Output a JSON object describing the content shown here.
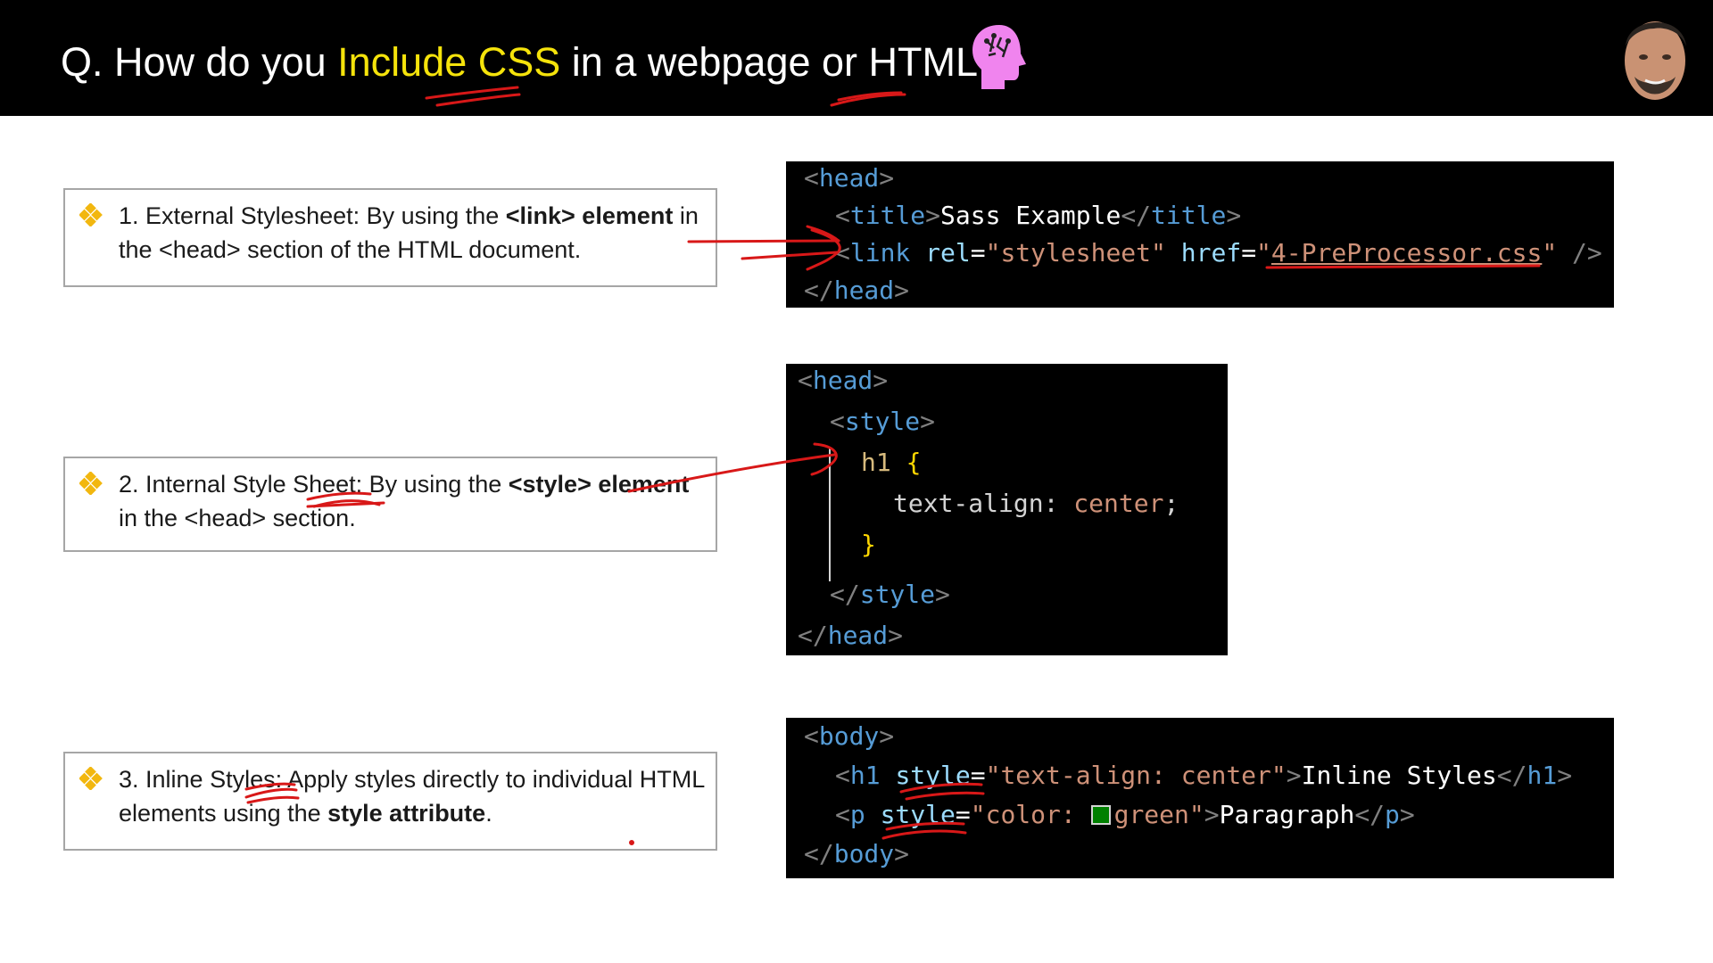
{
  "header": {
    "title_prefix": "Q. How do you ",
    "title_highlight": "Include CSS",
    "title_suffix": " in a webpage or HTML?"
  },
  "methods": [
    {
      "lead": "1. External Stylesheet: By using the ",
      "bold1": "<link> element",
      "rest": " in the <head> section of the HTML document."
    },
    {
      "lead": "2. Internal Style Sheet: By using the ",
      "bold1": "<style> element",
      "rest": " in the <head> section."
    },
    {
      "lead": "3. Inline Styles: Apply styles directly to individual HTML elements using the ",
      "bold1": "style attribute",
      "rest": "."
    }
  ],
  "code1": {
    "head_open": "head",
    "title_tag": "title",
    "title_text": "Sass Example",
    "link_tag": "link",
    "rel_attr": "rel",
    "rel_val": "\"stylesheet\"",
    "href_attr": "href",
    "href_q": "\"",
    "href_val": "4-PreProcessor.css",
    "selfclose": " />",
    "head_close": "head"
  },
  "code2": {
    "head_open": "head",
    "style_tag": "style",
    "selector": "h1",
    "brace_open": "{",
    "prop": "text-align",
    "value": "center",
    "brace_close": "}",
    "head_close": "head"
  },
  "code3": {
    "body_tag": "body",
    "h1_tag": "h1",
    "style_attr": "style",
    "h1_style": "\"text-align: center\"",
    "h1_text": "Inline Styles",
    "p_tag": "p",
    "p_style_a": "\"color: ",
    "p_style_b": "green\"",
    "p_text": "Paragraph"
  },
  "colors": {
    "highlight": "#f5e30b",
    "annotation": "#d81818",
    "bullet": "#f2b70f"
  },
  "icons": [
    "brain-head-icon",
    "presenter-avatar",
    "diamond-bullet-icon"
  ]
}
